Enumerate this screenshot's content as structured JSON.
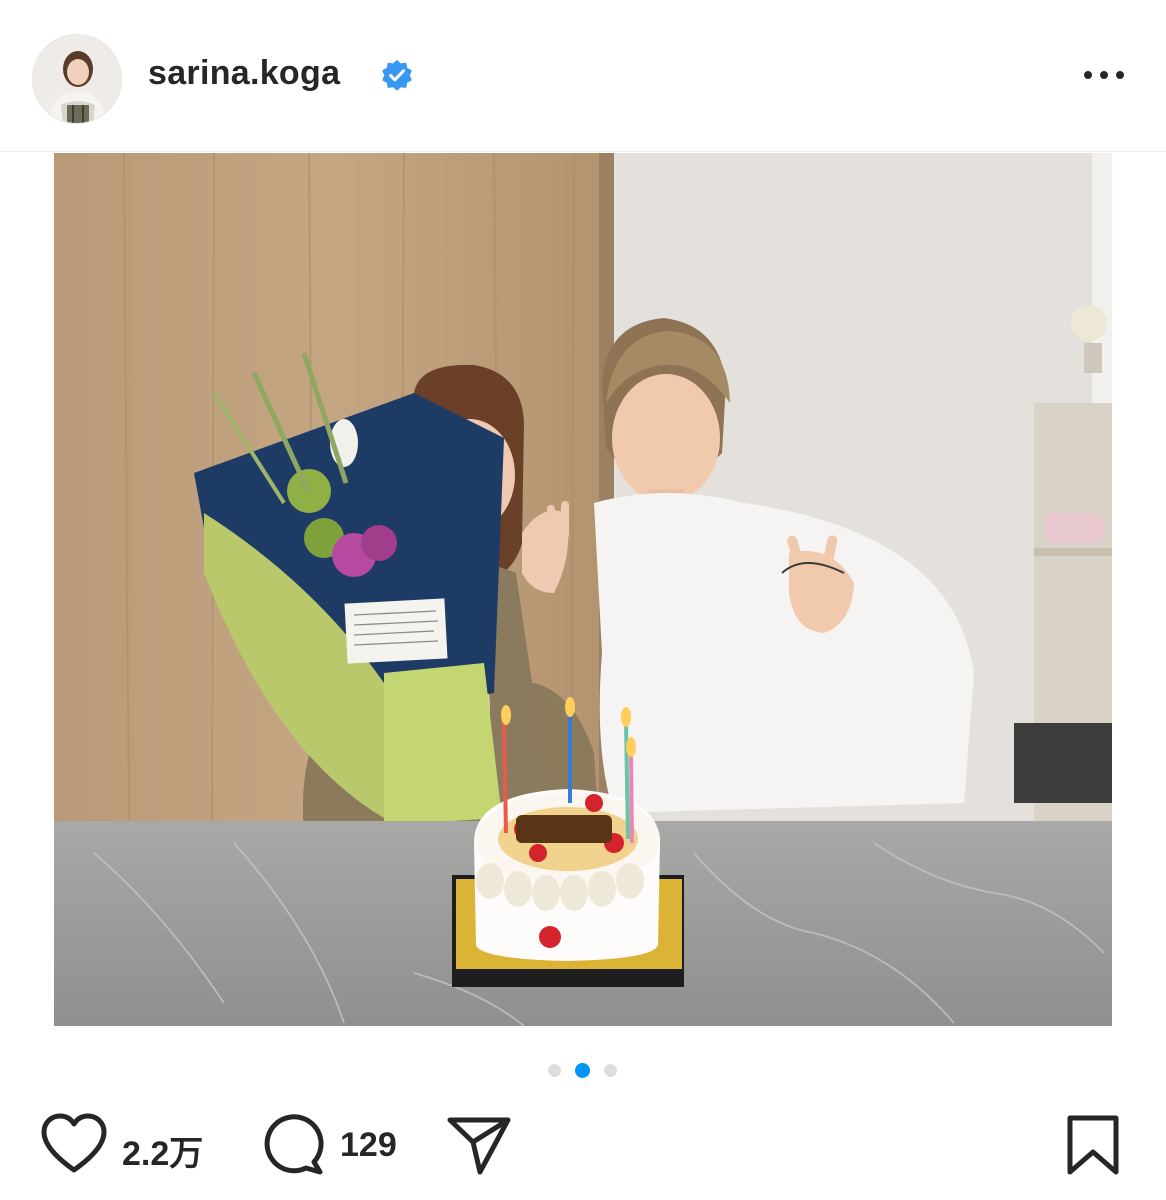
{
  "post": {
    "username": "sarina.koga",
    "verified": true,
    "verified_color": "#3897f0",
    "carousel": {
      "slide_count": 3,
      "active_index": 1,
      "active_color": "#0095f6"
    },
    "likes": "2.2万",
    "comments": "129"
  },
  "icons": {
    "verified": "verified-badge-icon",
    "more": "more-options-icon",
    "like": "heart-icon",
    "comment": "comment-icon",
    "share": "paper-plane-icon",
    "save": "bookmark-icon"
  }
}
